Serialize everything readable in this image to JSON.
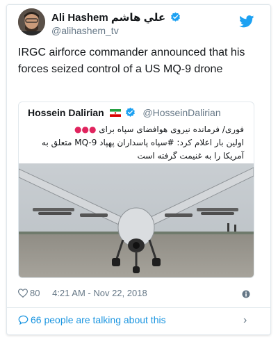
{
  "author": {
    "name": "Ali Hashem",
    "name_arabic": "علي هاشم",
    "handle": "@alihashem_tv"
  },
  "tweet": {
    "text": "IRGC airforce commander announced that his forces seized control of a US MQ-9 drone"
  },
  "quoted": {
    "name": "Hossein Dalirian",
    "handle": "@HosseinDalirian",
    "text_line1": "فوری/ فرمانده نیروی هوافضای سپاه برای",
    "text_line2": "اولین بار اعلام کرد: #سپاه پاسداران پهپاد MQ-9 متعلق به",
    "text_line3": "آمریکا را به غنیمت گرفته است",
    "image_alt": "MQ-9 drone on runway"
  },
  "meta": {
    "likes": "80",
    "timestamp": "4:21 AM - Nov 22, 2018"
  },
  "footer": {
    "talking": "66 people are talking about this"
  },
  "icons": {
    "verified": "verified-badge-icon",
    "bird": "twitter-bird-icon",
    "heart": "heart-icon",
    "info": "info-icon",
    "bubble": "speech-bubble-icon",
    "chevron": "chevron-right-icon"
  },
  "colors": {
    "accent": "#1da1f2",
    "link": "#1b95e0",
    "muted": "#657786",
    "alert_dot": "#e0245e"
  }
}
